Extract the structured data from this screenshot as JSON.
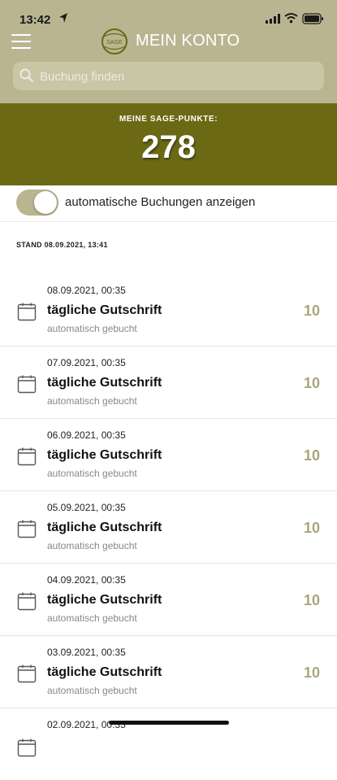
{
  "status_bar": {
    "time": "13:42"
  },
  "header": {
    "title": "MEIN KONTO",
    "logo_text": "SAGE",
    "search": {
      "placeholder": "Buchung finden",
      "value": ""
    }
  },
  "points": {
    "label": "MEINE SAGE-PUNKTE:",
    "value": "278"
  },
  "toggle": {
    "label": "automatische Buchungen anzeigen",
    "on": true
  },
  "stand": "STAND 08.09.2021, 13:41",
  "bookings": [
    {
      "date": "08.09.2021, 00:35",
      "title": "tägliche Gutschrift",
      "subtitle": "automatisch gebucht",
      "points": "10"
    },
    {
      "date": "07.09.2021, 00:35",
      "title": "tägliche Gutschrift",
      "subtitle": "automatisch gebucht",
      "points": "10"
    },
    {
      "date": "06.09.2021, 00:35",
      "title": "tägliche Gutschrift",
      "subtitle": "automatisch gebucht",
      "points": "10"
    },
    {
      "date": "05.09.2021, 00:35",
      "title": "tägliche Gutschrift",
      "subtitle": "automatisch gebucht",
      "points": "10"
    },
    {
      "date": "04.09.2021, 00:35",
      "title": "tägliche Gutschrift",
      "subtitle": "automatisch gebucht",
      "points": "10"
    },
    {
      "date": "03.09.2021, 00:35",
      "title": "tägliche Gutschrift",
      "subtitle": "automatisch gebucht",
      "points": "10"
    },
    {
      "date": "02.09.2021, 00:35",
      "title": "",
      "subtitle": "",
      "points": ""
    }
  ],
  "colors": {
    "header_bg": "#b8b590",
    "points_bg": "#6c6915",
    "accent": "#a9a67a"
  },
  "icons": [
    "location-arrow-icon",
    "signal-icon",
    "wifi-icon",
    "battery-icon",
    "menu-icon",
    "search-icon",
    "calendar-icon"
  ]
}
